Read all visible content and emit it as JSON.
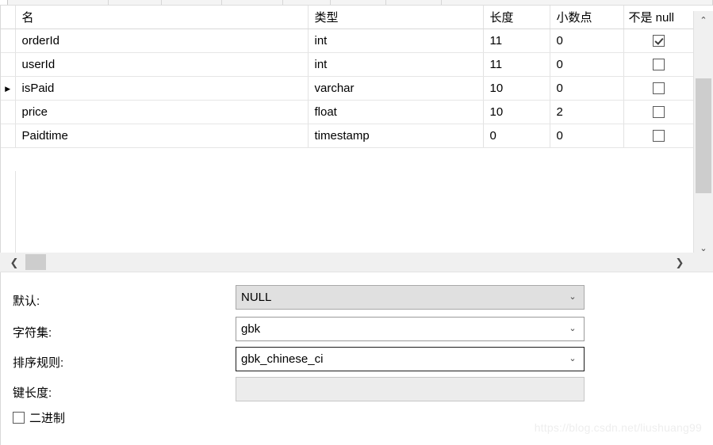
{
  "toolbar": {
    "segment_widths": [
      10,
      127,
      67,
      76,
      77,
      60,
      70,
      70,
      342
    ]
  },
  "grid": {
    "columns": [
      {
        "key": "name",
        "label": "名"
      },
      {
        "key": "type",
        "label": "类型"
      },
      {
        "key": "len",
        "label": "长度"
      },
      {
        "key": "dec",
        "label": "小数点"
      },
      {
        "key": "null",
        "label": "不是 null"
      }
    ],
    "rows": [
      {
        "marker": "",
        "name": "orderId",
        "type": "int",
        "len": "11",
        "dec": "0",
        "not_null": true
      },
      {
        "marker": "",
        "name": "userId",
        "type": "int",
        "len": "11",
        "dec": "0",
        "not_null": false
      },
      {
        "marker": "▶",
        "name": "isPaid",
        "type": "varchar",
        "len": "10",
        "dec": "0",
        "not_null": false
      },
      {
        "marker": "",
        "name": "price",
        "type": "float",
        "len": "10",
        "dec": "2",
        "not_null": false
      },
      {
        "marker": "",
        "name": "Paidtime",
        "type": "timestamp",
        "len": "0",
        "dec": "0",
        "not_null": false
      }
    ]
  },
  "vertical_scrollbar": {
    "up_arrow": "⌃",
    "down_arrow": "⌄"
  },
  "horizontal_scrollbar": {
    "left_arrow": "❮",
    "right_arrow": "❯"
  },
  "properties": [
    {
      "label": "默认:",
      "value": "NULL",
      "chevron": "⌄",
      "state": "disabled",
      "name": "default"
    },
    {
      "label": "字符集:",
      "value": "gbk",
      "chevron": "⌄",
      "state": "normal",
      "name": "charset"
    },
    {
      "label": "排序规则:",
      "value": "gbk_chinese_ci",
      "chevron": "⌄",
      "state": "focused",
      "name": "collation"
    },
    {
      "label": "键长度:",
      "value": "",
      "chevron": "",
      "state": "readonly-empty",
      "name": "key-length"
    }
  ],
  "binary_checkbox": {
    "label": "二进制",
    "checked": false
  },
  "watermark": {
    "text": "https://blog.csdn.net/liushuang99"
  },
  "colors": {
    "panel_bg": "#ffffff",
    "scrollbar_track": "#f0f0f0",
    "scrollbar_thumb": "#cdcdcd",
    "grid_line": "#e6e6e6",
    "disabled_field": "#e0e0e0"
  }
}
